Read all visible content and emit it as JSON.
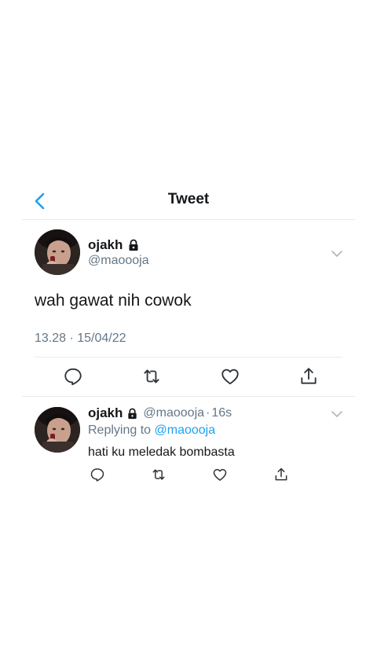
{
  "header": {
    "title": "Tweet",
    "back_icon": "chevron-left-icon"
  },
  "main_tweet": {
    "display_name": "ojakh",
    "handle": "@maoooja",
    "text": "wah gawat nih cowok",
    "timestamp": "13.28 · 15/04/22",
    "actions": [
      "reply-icon",
      "retweet-icon",
      "like-icon",
      "share-icon"
    ]
  },
  "reply_tweet": {
    "display_name": "ojakh",
    "handle": "@maoooja",
    "separator": "·",
    "time": "16s",
    "replying_prefix": "Replying to",
    "replying_to": "@maoooja",
    "text": "hati ku meledak bombasta",
    "actions": [
      "reply-icon",
      "retweet-icon",
      "like-icon",
      "share-icon"
    ]
  },
  "colors": {
    "accent": "#1da1f2",
    "text_primary": "#14171a",
    "text_secondary": "#657786",
    "divider": "#e6ecf0",
    "icon_gray": "#2f3336"
  }
}
